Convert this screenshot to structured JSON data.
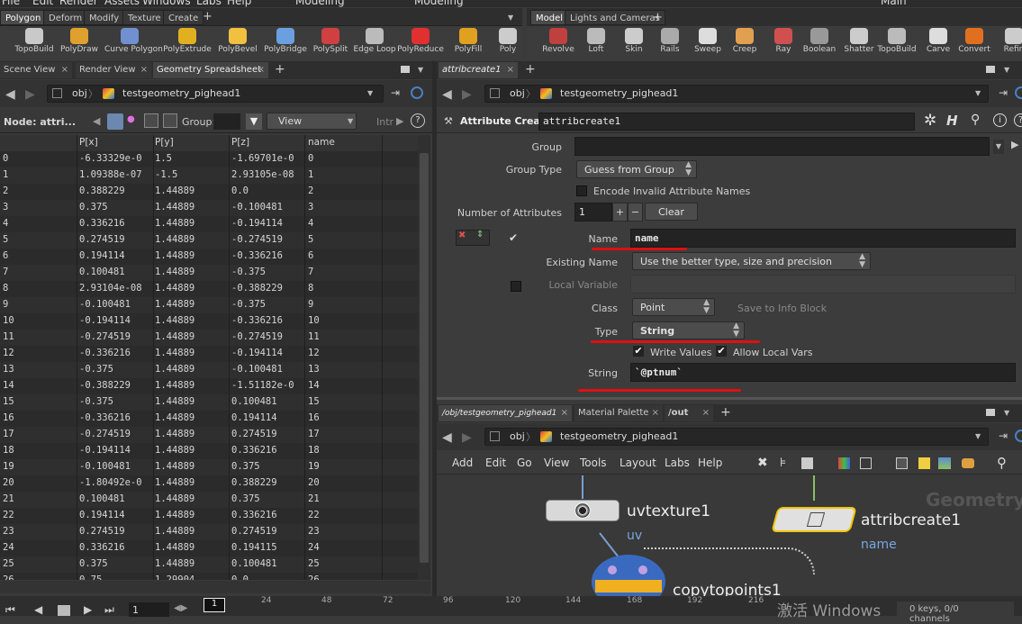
{
  "menubar": {
    "items": [
      "File",
      "Edit",
      "Render",
      "Assets",
      "Windows",
      "Labs",
      "Help"
    ],
    "desktop_left": "Modeling",
    "desktop_right": "Modeling",
    "main_label": "Main"
  },
  "shelf_left": {
    "tabs": [
      "Polygon",
      "Deform",
      "Modify",
      "Texture",
      "Create"
    ],
    "tools": [
      "TopoBuild",
      "PolyDraw",
      "Curve Polygon",
      "PolyExtrude",
      "PolyBevel",
      "PolyBridge",
      "PolySplit",
      "Edge Loop",
      "PolyReduce",
      "PolyFill",
      "Poly"
    ]
  },
  "shelf_right": {
    "tabs": [
      "Model",
      "Lights and Cameras"
    ],
    "tools": [
      "Revolve",
      "Loft",
      "Skin",
      "Rails",
      "Sweep",
      "Creep",
      "Ray",
      "Boolean",
      "Shatter",
      "TopoBuild",
      "Carve",
      "Convert",
      "Refin"
    ]
  },
  "left_pane": {
    "tabs": [
      "Scene View",
      "Render View",
      "Geometry Spreadsheet"
    ],
    "path_root": "obj",
    "path_node": "testgeometry_pighead1",
    "node_label": "Node: attri...",
    "group_label": "Group:",
    "view_label": "View",
    "intr_label": "Intr"
  },
  "spreadsheet": {
    "columns": [
      "",
      "P[x]",
      "P[y]",
      "P[z]",
      "name"
    ],
    "rows": [
      [
        "0",
        "-6.33329e-0",
        "1.5",
        "-1.69701e-0",
        "0"
      ],
      [
        "1",
        "1.09388e-07",
        "-1.5",
        "2.93105e-08",
        "1"
      ],
      [
        "2",
        "0.388229",
        "1.44889",
        "0.0",
        "2"
      ],
      [
        "3",
        "0.375",
        "1.44889",
        "-0.100481",
        "3"
      ],
      [
        "4",
        "0.336216",
        "1.44889",
        "-0.194114",
        "4"
      ],
      [
        "5",
        "0.274519",
        "1.44889",
        "-0.274519",
        "5"
      ],
      [
        "6",
        "0.194114",
        "1.44889",
        "-0.336216",
        "6"
      ],
      [
        "7",
        "0.100481",
        "1.44889",
        "-0.375",
        "7"
      ],
      [
        "8",
        "2.93104e-08",
        "1.44889",
        "-0.388229",
        "8"
      ],
      [
        "9",
        "-0.100481",
        "1.44889",
        "-0.375",
        "9"
      ],
      [
        "10",
        "-0.194114",
        "1.44889",
        "-0.336216",
        "10"
      ],
      [
        "11",
        "-0.274519",
        "1.44889",
        "-0.274519",
        "11"
      ],
      [
        "12",
        "-0.336216",
        "1.44889",
        "-0.194114",
        "12"
      ],
      [
        "13",
        "-0.375",
        "1.44889",
        "-0.100481",
        "13"
      ],
      [
        "14",
        "-0.388229",
        "1.44889",
        "-1.51182e-0",
        "14"
      ],
      [
        "15",
        "-0.375",
        "1.44889",
        "0.100481",
        "15"
      ],
      [
        "16",
        "-0.336216",
        "1.44889",
        "0.194114",
        "16"
      ],
      [
        "17",
        "-0.274519",
        "1.44889",
        "0.274519",
        "17"
      ],
      [
        "18",
        "-0.194114",
        "1.44889",
        "0.336216",
        "18"
      ],
      [
        "19",
        "-0.100481",
        "1.44889",
        "0.375",
        "19"
      ],
      [
        "20",
        "-1.80492e-0",
        "1.44889",
        "0.388229",
        "20"
      ],
      [
        "21",
        "0.100481",
        "1.44889",
        "0.375",
        "21"
      ],
      [
        "22",
        "0.194114",
        "1.44889",
        "0.336216",
        "22"
      ],
      [
        "23",
        "0.274519",
        "1.44889",
        "0.274519",
        "23"
      ],
      [
        "24",
        "0.336216",
        "1.44889",
        "0.194115",
        "24"
      ],
      [
        "25",
        "0.375",
        "1.44889",
        "0.100481",
        "25"
      ],
      [
        "26",
        "0.75",
        "1.29904",
        "0.0",
        "26"
      ]
    ]
  },
  "right_pane": {
    "tabs": [
      "attribcreate1"
    ],
    "path_root": "obj",
    "path_node": "testgeometry_pighead1",
    "node_type": "Attribute Create",
    "node_name": "attribcreate1"
  },
  "parms": {
    "group_label": "Group",
    "group_value": "",
    "group_type_label": "Group Type",
    "group_type_value": "Guess from Group",
    "encode_label": "Encode Invalid Attribute Names",
    "num_attr_label": "Number of Attributes",
    "num_attr_value": "1",
    "plus": "+",
    "minus": "−",
    "clear_label": "Clear",
    "name_label": "Name",
    "name_value": "name",
    "existing_label": "Existing Name",
    "existing_value": "Use the better type, size and precision",
    "local_var_label": "Local Variable",
    "class_label": "Class",
    "class_value": "Point",
    "save_info_label": "Save to Info Block",
    "type_label": "Type",
    "type_value": "String",
    "write_values_label": "Write Values",
    "allow_local_label": "Allow Local Vars",
    "string_label": "String",
    "string_value": "`@ptnum`"
  },
  "network": {
    "tabs": [
      "/obj/testgeometry_pighead1",
      "Material Palette",
      "/out"
    ],
    "path_root": "obj",
    "path_node": "testgeometry_pighead1",
    "menu": [
      "Add",
      "Edit",
      "Go",
      "View",
      "Tools",
      "Layout",
      "Labs",
      "Help"
    ],
    "watermark": "Geometry",
    "nodes": [
      {
        "name": "uvtexture1",
        "sub": "uv"
      },
      {
        "name": "attribcreate1",
        "sub": "name"
      },
      {
        "name": "copytopoints1",
        "sub": ""
      }
    ]
  },
  "timeline": {
    "frame": "1",
    "frame_field": "1",
    "ticks": [
      "24",
      "48",
      "72",
      "96",
      "120",
      "144",
      "168",
      "192",
      "216"
    ],
    "keys": "0 keys, 0/0 channels",
    "activate": "激活 Windows"
  },
  "colors": {
    "accent": "#f2c400",
    "red_mark": "#e01010",
    "spreadsheet_bg": "#2b2b2b"
  }
}
